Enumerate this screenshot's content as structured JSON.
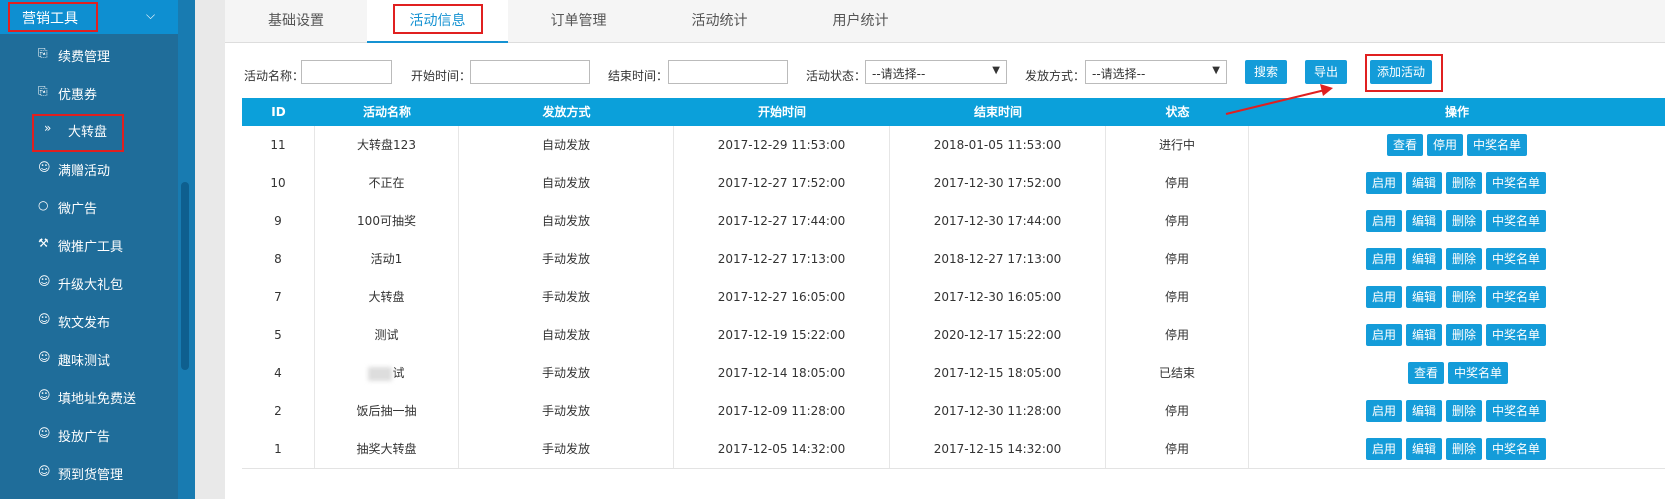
{
  "sidebar": {
    "group_label": "营销工具",
    "items": [
      {
        "label": "续费管理",
        "icon": "doc-yen-icon"
      },
      {
        "label": "优惠券",
        "icon": "doc-yen-icon"
      },
      {
        "label": "大转盘",
        "icon": "double-chevron-right-icon"
      },
      {
        "label": "满赠活动",
        "icon": "users-icon"
      },
      {
        "label": "微广告",
        "icon": "ad-icon"
      },
      {
        "label": "微推广工具",
        "icon": "megaphone-icon"
      },
      {
        "label": "升级大礼包",
        "icon": "users-icon"
      },
      {
        "label": "软文发布",
        "icon": "users-icon"
      },
      {
        "label": "趣味测试",
        "icon": "users-icon"
      },
      {
        "label": "填地址免费送",
        "icon": "users-icon"
      },
      {
        "label": "投放广告",
        "icon": "users-icon"
      },
      {
        "label": "预到货管理",
        "icon": "users-icon"
      }
    ]
  },
  "tabs": [
    "基础设置",
    "活动信息",
    "订单管理",
    "活动统计",
    "用户统计"
  ],
  "filters": {
    "name_label": "活动名称：",
    "start_label": "开始时间：",
    "end_label": "结束时间：",
    "status_label": "活动状态：",
    "status_value": "--请选择--",
    "method_label": "发放方式：",
    "method_value": "--请选择--",
    "search": "搜索",
    "export": "导出",
    "add": "添加活动"
  },
  "table": {
    "headers": [
      "ID",
      "活动名称",
      "发放方式",
      "开始时间",
      "结束时间",
      "状态",
      "操作"
    ],
    "rows": [
      {
        "id": "11",
        "name": "大转盘123",
        "method": "自动发放",
        "start": "2017-12-29 11:53:00",
        "end": "2018-01-05 11:53:00",
        "status": "进行中",
        "ops": [
          "查看",
          "停用",
          "中奖名单"
        ]
      },
      {
        "id": "10",
        "name": "不正在",
        "method": "自动发放",
        "start": "2017-12-27 17:52:00",
        "end": "2017-12-30 17:52:00",
        "status": "停用",
        "ops": [
          "启用",
          "编辑",
          "删除",
          "中奖名单"
        ]
      },
      {
        "id": "9",
        "name": "100可抽奖",
        "method": "自动发放",
        "start": "2017-12-27 17:44:00",
        "end": "2017-12-30 17:44:00",
        "status": "停用",
        "ops": [
          "启用",
          "编辑",
          "删除",
          "中奖名单"
        ]
      },
      {
        "id": "8",
        "name": "活动1",
        "method": "手动发放",
        "start": "2017-12-27 17:13:00",
        "end": "2018-12-27 17:13:00",
        "status": "停用",
        "ops": [
          "启用",
          "编辑",
          "删除",
          "中奖名单"
        ]
      },
      {
        "id": "7",
        "name": "大转盘",
        "method": "手动发放",
        "start": "2017-12-27 16:05:00",
        "end": "2017-12-30 16:05:00",
        "status": "停用",
        "ops": [
          "启用",
          "编辑",
          "删除",
          "中奖名单"
        ]
      },
      {
        "id": "5",
        "name": "测试",
        "method": "自动发放",
        "start": "2017-12-19 15:22:00",
        "end": "2020-12-17 15:22:00",
        "status": "停用",
        "ops": [
          "启用",
          "编辑",
          "删除",
          "中奖名单"
        ]
      },
      {
        "id": "4",
        "name": "试",
        "method": "手动发放",
        "start": "2017-12-14 18:05:00",
        "end": "2017-12-15 18:05:00",
        "status": "已结束",
        "ops": [
          "查看",
          "中奖名单"
        ]
      },
      {
        "id": "2",
        "name": "饭后抽一抽",
        "method": "手动发放",
        "start": "2017-12-09 11:28:00",
        "end": "2017-12-30 11:28:00",
        "status": "停用",
        "ops": [
          "启用",
          "编辑",
          "删除",
          "中奖名单"
        ]
      },
      {
        "id": "1",
        "name": "抽奖大转盘",
        "method": "手动发放",
        "start": "2017-12-05 14:32:00",
        "end": "2017-12-15 14:32:00",
        "status": "停用",
        "ops": [
          "启用",
          "编辑",
          "删除",
          "中奖名单"
        ]
      }
    ]
  }
}
